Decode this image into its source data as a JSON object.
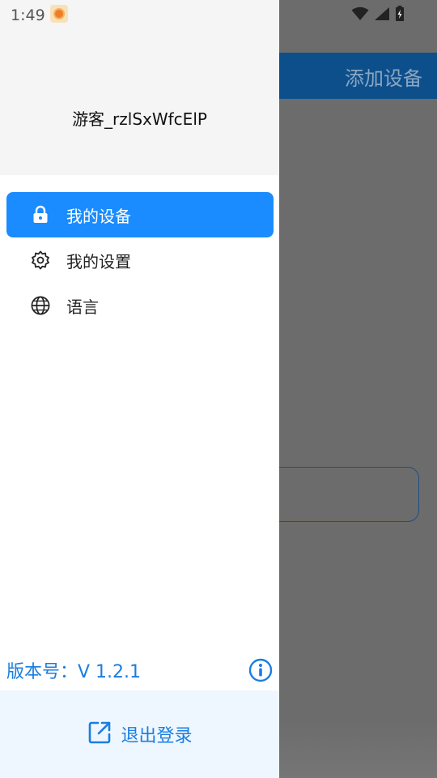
{
  "status_bar": {
    "time": "1:49"
  },
  "background_app": {
    "title": "添加设备"
  },
  "drawer": {
    "user_name": "游客_rzlSxWfcElP",
    "menu": [
      {
        "label": "我的设备",
        "icon": "lock-icon",
        "active": true
      },
      {
        "label": "我的设置",
        "icon": "gear-icon",
        "active": false
      },
      {
        "label": "语言",
        "icon": "globe-icon",
        "active": false
      }
    ],
    "version": "版本号：V 1.2.1",
    "logout_label": "退出登录"
  },
  "colors": {
    "accent": "#1a8cff",
    "link_blue": "#1a7ee0",
    "overlay": "#6c6c6c",
    "appbar": "#0d4f8b"
  }
}
